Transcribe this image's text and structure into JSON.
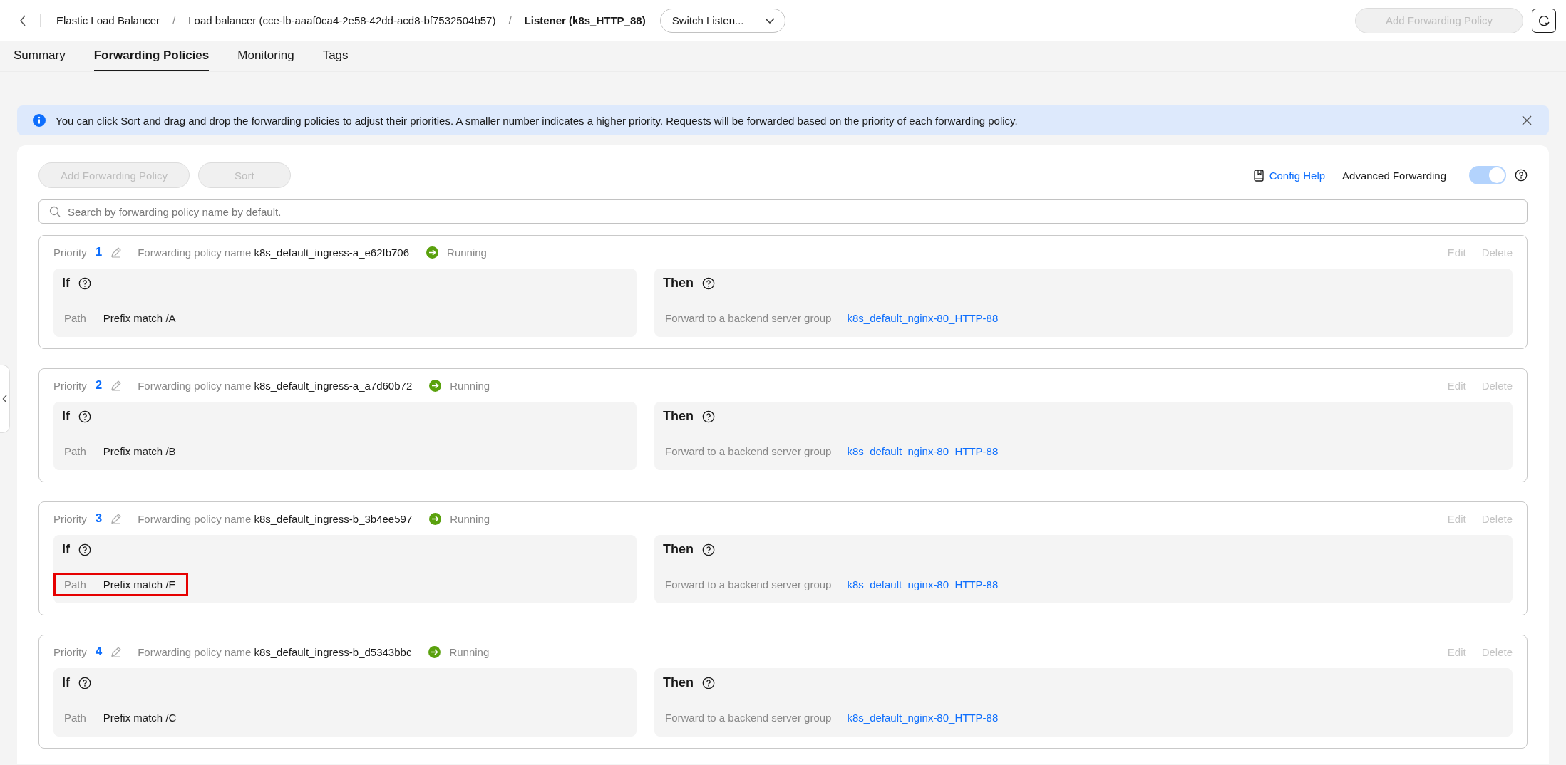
{
  "breadcrumb": {
    "separator": "/",
    "items": [
      "Elastic Load Balancer",
      "Load balancer (cce-lb-aaaf0ca4-2e58-42dd-acd8-bf7532504b57)"
    ],
    "current": "Listener (k8s_HTTP_88)"
  },
  "listener_switch": {
    "value": "Switch Listen..."
  },
  "header_button": {
    "label": "Add Forwarding Policy",
    "disabled": true
  },
  "tabs": [
    {
      "label": "Summary",
      "selected": false
    },
    {
      "label": "Forwarding Policies",
      "selected": true
    },
    {
      "label": "Monitoring",
      "selected": false
    },
    {
      "label": "Tags",
      "selected": false
    }
  ],
  "notice": {
    "text": "You can click Sort and drag and drop the forwarding policies to adjust their priorities. A smaller number indicates a higher priority. Requests will be forwarded based on the priority of each forwarding policy."
  },
  "toolbar": {
    "buttons": [
      {
        "label": "Add Forwarding Policy",
        "disabled": true
      },
      {
        "label": "Sort",
        "disabled": true
      }
    ],
    "config_help": "Config Help",
    "advanced_forwarding": {
      "label": "Advanced Forwarding",
      "on": true
    }
  },
  "search": {
    "placeholder": "Search by forwarding policy name by default."
  },
  "policies": [
    {
      "priority_label": "Priority",
      "priority": "1",
      "name_label": "Forwarding policy name",
      "name": "k8s_default_ingress-a_e62fb706",
      "status": "Running",
      "actions": [
        {
          "label": "Edit",
          "disabled": true
        },
        {
          "label": "Delete",
          "disabled": true
        }
      ],
      "if": {
        "title": "If",
        "condition_label": "Path",
        "condition": "Prefix match /A",
        "highlighted": false
      },
      "then": {
        "title": "Then",
        "action_label": "Forward to a backend server group",
        "target": "k8s_default_nginx-80_HTTP-88"
      }
    },
    {
      "priority_label": "Priority",
      "priority": "2",
      "name_label": "Forwarding policy name",
      "name": "k8s_default_ingress-a_a7d60b72",
      "status": "Running",
      "actions": [
        {
          "label": "Edit",
          "disabled": true
        },
        {
          "label": "Delete",
          "disabled": true
        }
      ],
      "if": {
        "title": "If",
        "condition_label": "Path",
        "condition": "Prefix match /B",
        "highlighted": false
      },
      "then": {
        "title": "Then",
        "action_label": "Forward to a backend server group",
        "target": "k8s_default_nginx-80_HTTP-88"
      }
    },
    {
      "priority_label": "Priority",
      "priority": "3",
      "name_label": "Forwarding policy name",
      "name": "k8s_default_ingress-b_3b4ee597",
      "status": "Running",
      "actions": [
        {
          "label": "Edit",
          "disabled": true
        },
        {
          "label": "Delete",
          "disabled": true
        }
      ],
      "if": {
        "title": "If",
        "condition_label": "Path",
        "condition": "Prefix match /E",
        "highlighted": true
      },
      "then": {
        "title": "Then",
        "action_label": "Forward to a backend server group",
        "target": "k8s_default_nginx-80_HTTP-88"
      }
    },
    {
      "priority_label": "Priority",
      "priority": "4",
      "name_label": "Forwarding policy name",
      "name": "k8s_default_ingress-b_d5343bbc",
      "status": "Running",
      "actions": [
        {
          "label": "Edit",
          "disabled": true
        },
        {
          "label": "Delete",
          "disabled": true
        }
      ],
      "if": {
        "title": "If",
        "condition_label": "Path",
        "condition": "Prefix match /C",
        "highlighted": false
      },
      "then": {
        "title": "Then",
        "action_label": "Forward to a backend server group",
        "target": "k8s_default_nginx-80_HTTP-88"
      }
    }
  ]
}
